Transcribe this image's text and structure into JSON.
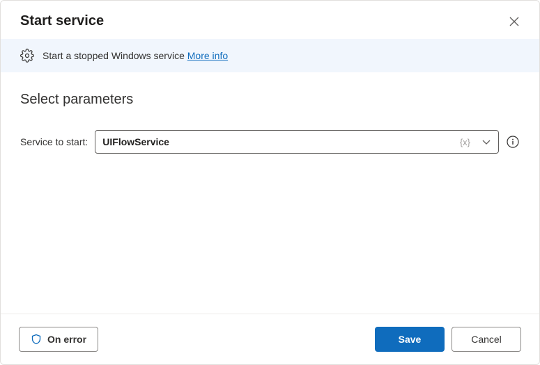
{
  "dialog": {
    "title": "Start service"
  },
  "info_bar": {
    "text": "Start a stopped Windows service",
    "more_info_label": "More info"
  },
  "section": {
    "title": "Select parameters"
  },
  "fields": {
    "service_to_start": {
      "label": "Service to start:",
      "value": "UIFlowService",
      "var_token": "{x}"
    }
  },
  "footer": {
    "on_error_label": "On error",
    "save_label": "Save",
    "cancel_label": "Cancel"
  }
}
